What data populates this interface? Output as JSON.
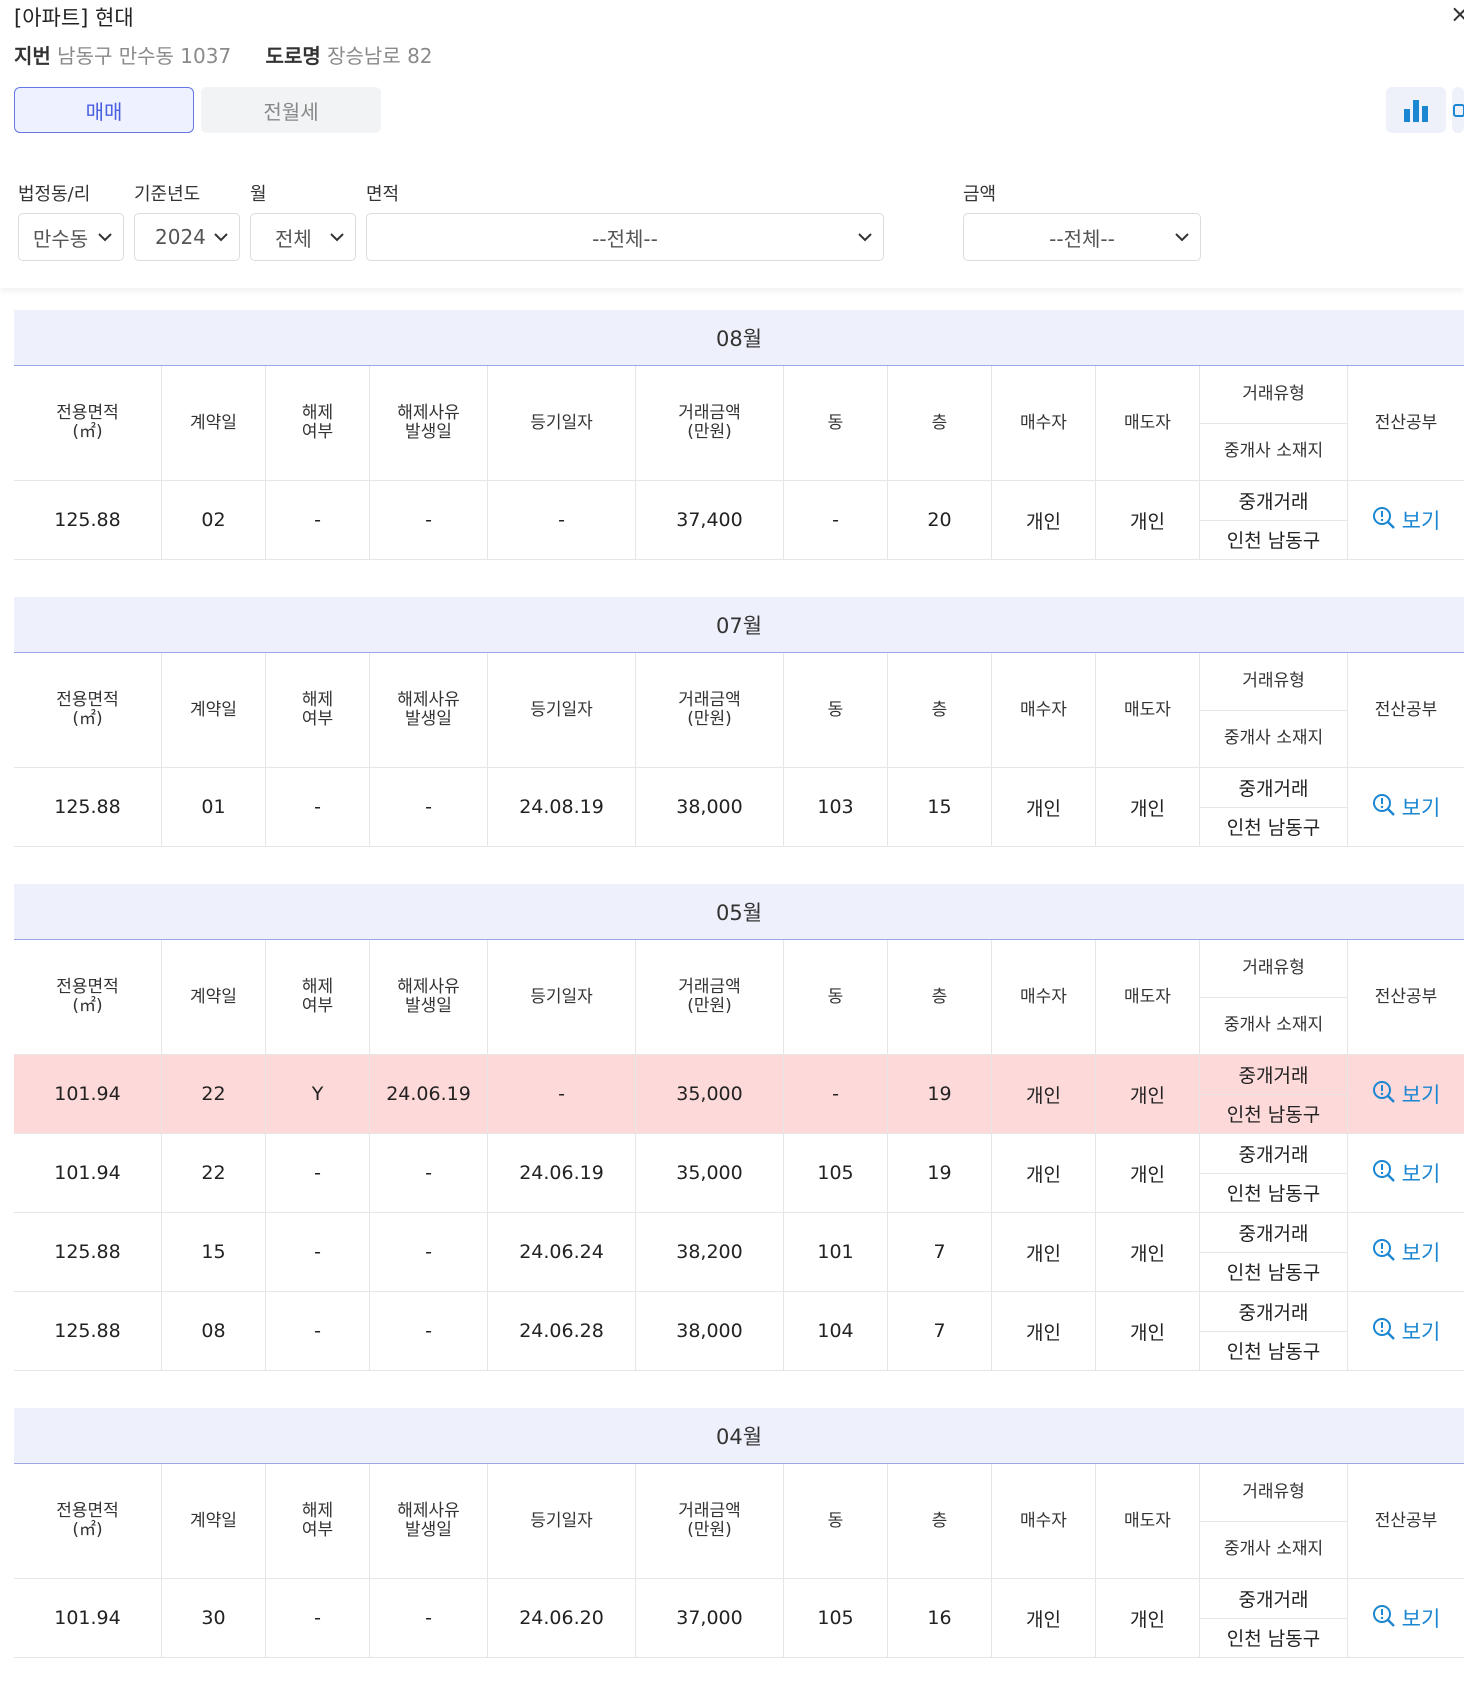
{
  "header": {
    "title": "[아파트] 현대",
    "close": "×",
    "jibun_label": "지번",
    "jibun_value": "남동구 만수동 1037",
    "road_label": "도로명",
    "road_value": "장승남로 82"
  },
  "tabs": {
    "sale": "매매",
    "rent": "전월세"
  },
  "toolbar": {
    "chart_icon": "bar-chart-icon",
    "print_icon": "printer-icon"
  },
  "filters": {
    "dong_label": "법정동/리",
    "dong_value": "만수동",
    "year_label": "기준년도",
    "year_value": "2024",
    "month_label": "월",
    "month_value": "전체",
    "area_label": "면적",
    "area_value": "--전체--",
    "price_label": "금액",
    "price_value": "--전체--"
  },
  "columns": {
    "area": "전용면적\n(㎡)",
    "date": "계약일",
    "cancel": "해제\n여부",
    "cancel_date": "해제사유\n발생일",
    "reg_date": "등기일자",
    "price": "거래금액\n(만원)",
    "dong": "동",
    "floor": "층",
    "buyer": "매수자",
    "seller": "매도자",
    "type": "거래유형",
    "agent_loc": "중개사 소재지",
    "doc": "전산공부"
  },
  "view_label": "보기",
  "months": [
    {
      "label": "08월",
      "rows": [
        {
          "area": "125.88",
          "day": "02",
          "cancel": "-",
          "cancel_date": "-",
          "reg_date": "-",
          "price": "37,400",
          "dong": "-",
          "floor": "20",
          "buyer": "개인",
          "seller": "개인",
          "type": "중개거래",
          "loc": "인천 남동구",
          "canceled": false
        }
      ]
    },
    {
      "label": "07월",
      "rows": [
        {
          "area": "125.88",
          "day": "01",
          "cancel": "-",
          "cancel_date": "-",
          "reg_date": "24.08.19",
          "price": "38,000",
          "dong": "103",
          "floor": "15",
          "buyer": "개인",
          "seller": "개인",
          "type": "중개거래",
          "loc": "인천 남동구",
          "canceled": false
        }
      ]
    },
    {
      "label": "05월",
      "rows": [
        {
          "area": "101.94",
          "day": "22",
          "cancel": "Y",
          "cancel_date": "24.06.19",
          "reg_date": "-",
          "price": "35,000",
          "dong": "-",
          "floor": "19",
          "buyer": "개인",
          "seller": "개인",
          "type": "중개거래",
          "loc": "인천 남동구",
          "canceled": true
        },
        {
          "area": "101.94",
          "day": "22",
          "cancel": "-",
          "cancel_date": "-",
          "reg_date": "24.06.19",
          "price": "35,000",
          "dong": "105",
          "floor": "19",
          "buyer": "개인",
          "seller": "개인",
          "type": "중개거래",
          "loc": "인천 남동구",
          "canceled": false
        },
        {
          "area": "125.88",
          "day": "15",
          "cancel": "-",
          "cancel_date": "-",
          "reg_date": "24.06.24",
          "price": "38,200",
          "dong": "101",
          "floor": "7",
          "buyer": "개인",
          "seller": "개인",
          "type": "중개거래",
          "loc": "인천 남동구",
          "canceled": false
        },
        {
          "area": "125.88",
          "day": "08",
          "cancel": "-",
          "cancel_date": "-",
          "reg_date": "24.06.28",
          "price": "38,000",
          "dong": "104",
          "floor": "7",
          "buyer": "개인",
          "seller": "개인",
          "type": "중개거래",
          "loc": "인천 남동구",
          "canceled": false
        }
      ]
    },
    {
      "label": "04월",
      "rows": [
        {
          "area": "101.94",
          "day": "30",
          "cancel": "-",
          "cancel_date": "-",
          "reg_date": "24.06.20",
          "price": "37,000",
          "dong": "105",
          "floor": "16",
          "buyer": "개인",
          "seller": "개인",
          "type": "중개거래",
          "loc": "인천 남동구",
          "canceled": false
        }
      ]
    }
  ],
  "colors": {
    "accent": "#4a5fe0",
    "link": "#1b86d1",
    "canceled_row": "#fdd9da",
    "month_header": "#eef1fb"
  }
}
